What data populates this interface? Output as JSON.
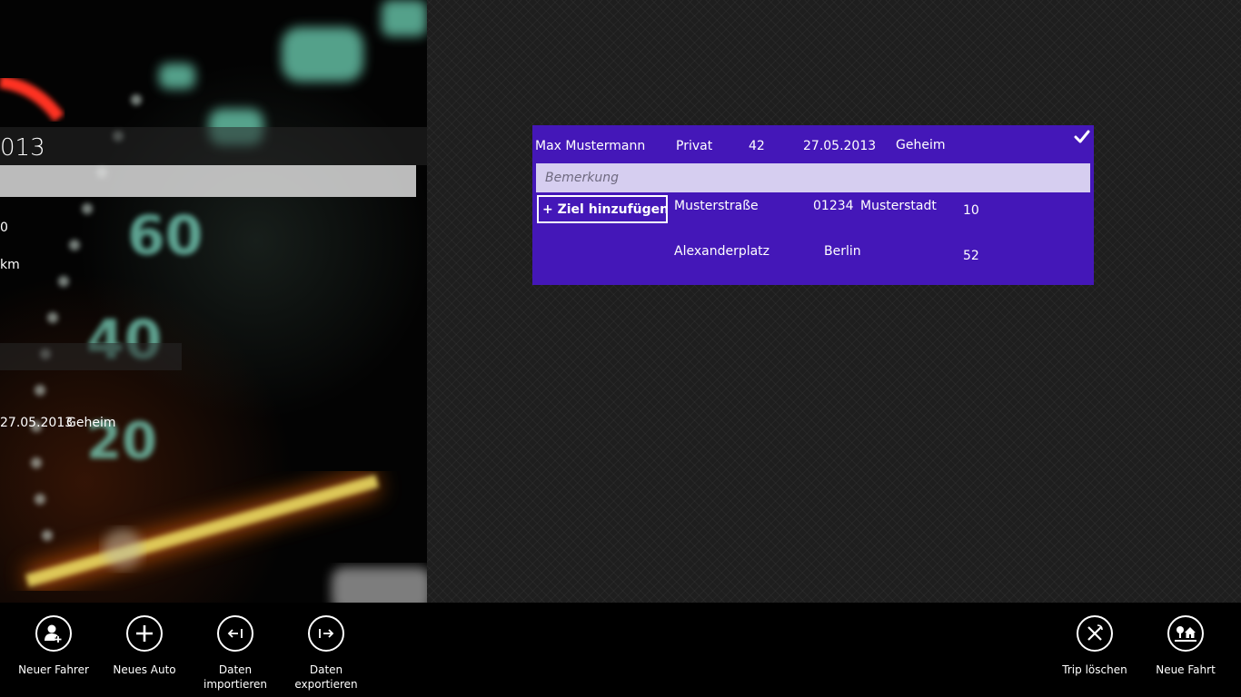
{
  "left_panel": {
    "year_fragment": "013",
    "value_fragment": "0",
    "unit_fragment": "km",
    "trip_date": "27.05.2013",
    "trip_note": "Geheim"
  },
  "trip_card": {
    "driver": "Max Mustermann",
    "type": "Privat",
    "km": "42",
    "date": "27.05.2013",
    "note": "Geheim",
    "remark_placeholder": "Bemerkung",
    "add_target_label": "+ Ziel hinzufügen",
    "destinations": [
      {
        "street": "Musterstraße",
        "zip": "01234",
        "city": "Musterstadt",
        "distance": "10"
      },
      {
        "street": "Alexanderplatz",
        "zip": "",
        "city": "Berlin",
        "distance": "52"
      }
    ],
    "accent_color": "#4417b8"
  },
  "appbar": {
    "new_driver": "Neuer Fahrer",
    "new_car": "Neues Auto",
    "import_data": "Daten importieren",
    "export_data": "Daten exportieren",
    "delete_trip": "Trip löschen",
    "new_trip": "Neue Fahrt"
  }
}
